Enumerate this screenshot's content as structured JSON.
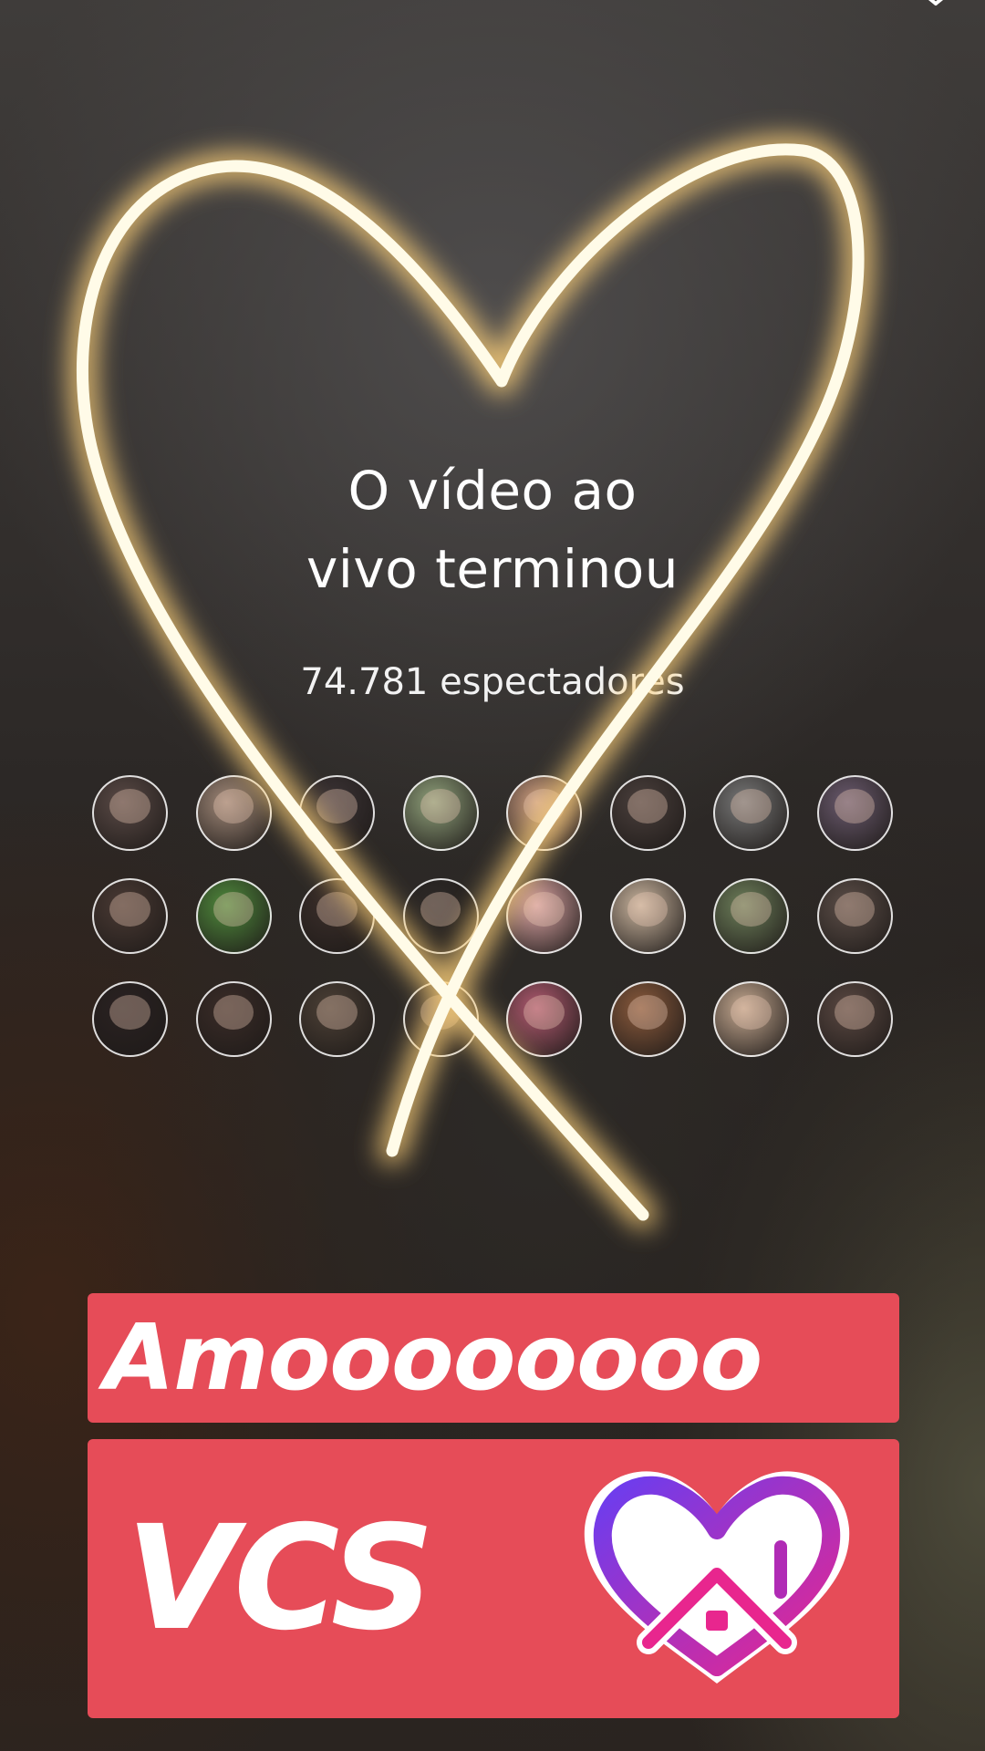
{
  "live_ended": {
    "title_line1": "O vídeo ao",
    "title_line2": "vivo terminou",
    "viewers_text": "74.781 espectadores"
  },
  "viewer_avatars": {
    "colors": [
      "#5a4a46",
      "#a08878",
      "#3c3436",
      "#8fa07a",
      "#c4967c",
      "#4a3f3c",
      "#777777",
      "#6a5a6e",
      "#4a3a34",
      "#4f8a3c",
      "#3a2e2a",
      "#2e2a28",
      "#d9a3a3",
      "#c9b49e",
      "#6d7f5a",
      "#5c4e48",
      "#2a2222",
      "#3a2c28",
      "#4c4036",
      "#3c3430",
      "#b05a70",
      "#8a5a3c",
      "#c4a890",
      "#5a4842"
    ]
  },
  "story_text": {
    "caption_line1": "Amoooooooo",
    "caption_line2": "VCS",
    "box_color": "#e64c58"
  },
  "colors": {
    "glow": "#ffd27a",
    "heart_core": "#fffbe8",
    "sticker_purple": "#6a3df0",
    "sticker_pink": "#e8268e"
  },
  "icons": {
    "close": "close-icon",
    "sticker": "house-heart-icon"
  }
}
